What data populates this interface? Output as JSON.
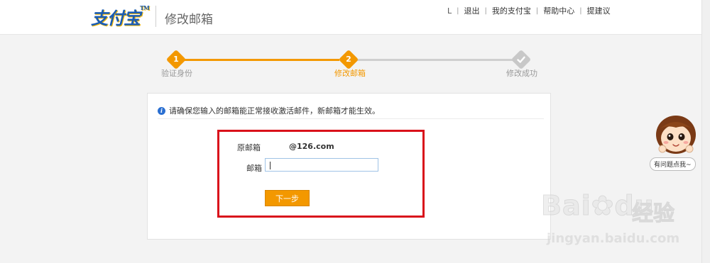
{
  "header": {
    "logo_text": "支付宝",
    "logo_mark": "TM",
    "page_title": "修改邮箱",
    "user_name": "L",
    "nav": [
      "退出",
      "我的支付宝",
      "帮助中心",
      "提建议"
    ]
  },
  "steps": [
    {
      "number": "1",
      "label": "验证身份",
      "status": "done"
    },
    {
      "number": "2",
      "label": "修改邮箱",
      "status": "current"
    },
    {
      "icon": "check-icon",
      "label": "修改成功",
      "status": "todo"
    }
  ],
  "form": {
    "notice": "请确保您输入的邮箱能正常接收激活邮件，新邮箱才能生效。",
    "original_label": "原邮箱",
    "original_value": "@126.com",
    "email_label": "邮箱",
    "email_value": "",
    "next_button": "下一步"
  },
  "help": {
    "bubble_text": "有问题点我~"
  },
  "watermark": {
    "main": "Bai",
    "paw": "du",
    "cn": "经验",
    "url": "jingyan.baidu.com"
  },
  "colors": {
    "accent": "#f39800",
    "highlight": "#d9111b",
    "logo_blue": "#1a5cb3"
  }
}
